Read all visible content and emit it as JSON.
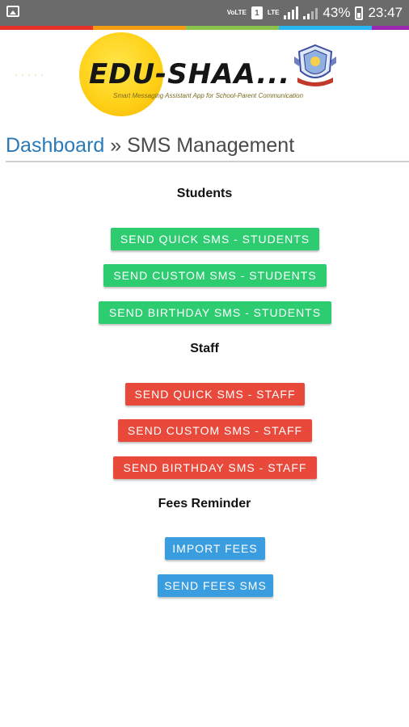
{
  "status_bar": {
    "network_label": "VoLTE",
    "lte_label": "LTE",
    "sim_label": "1",
    "battery": "43%",
    "time": "23:47"
  },
  "colors": {
    "strip": [
      "#e8312a",
      "#f39c12",
      "#8bc34a",
      "#29b6f6",
      "#9c27b0"
    ],
    "green": "#2ecc71",
    "red": "#e8493b",
    "blue": "#3a9de0",
    "link": "#2a7ab8"
  },
  "logo": {
    "brand": "EDU-SHAA...",
    "tagline": "Smart Messaging Assistant App for School-Parent Communication"
  },
  "breadcrumb": {
    "link": "Dashboard",
    "separator": " » ",
    "current": "SMS Management"
  },
  "sections": {
    "students": {
      "title": "Students",
      "buttons": [
        "SEND QUICK SMS - STUDENTS",
        "SEND CUSTOM SMS - STUDENTS",
        "SEND BIRTHDAY SMS - STUDENTS"
      ]
    },
    "staff": {
      "title": "Staff",
      "buttons": [
        "SEND QUICK SMS - STAFF",
        "SEND CUSTOM SMS - STAFF",
        "SEND BIRTHDAY SMS - STAFF"
      ]
    },
    "fees": {
      "title": "Fees Reminder",
      "buttons": [
        "IMPORT FEES",
        "SEND FEES SMS"
      ]
    }
  }
}
